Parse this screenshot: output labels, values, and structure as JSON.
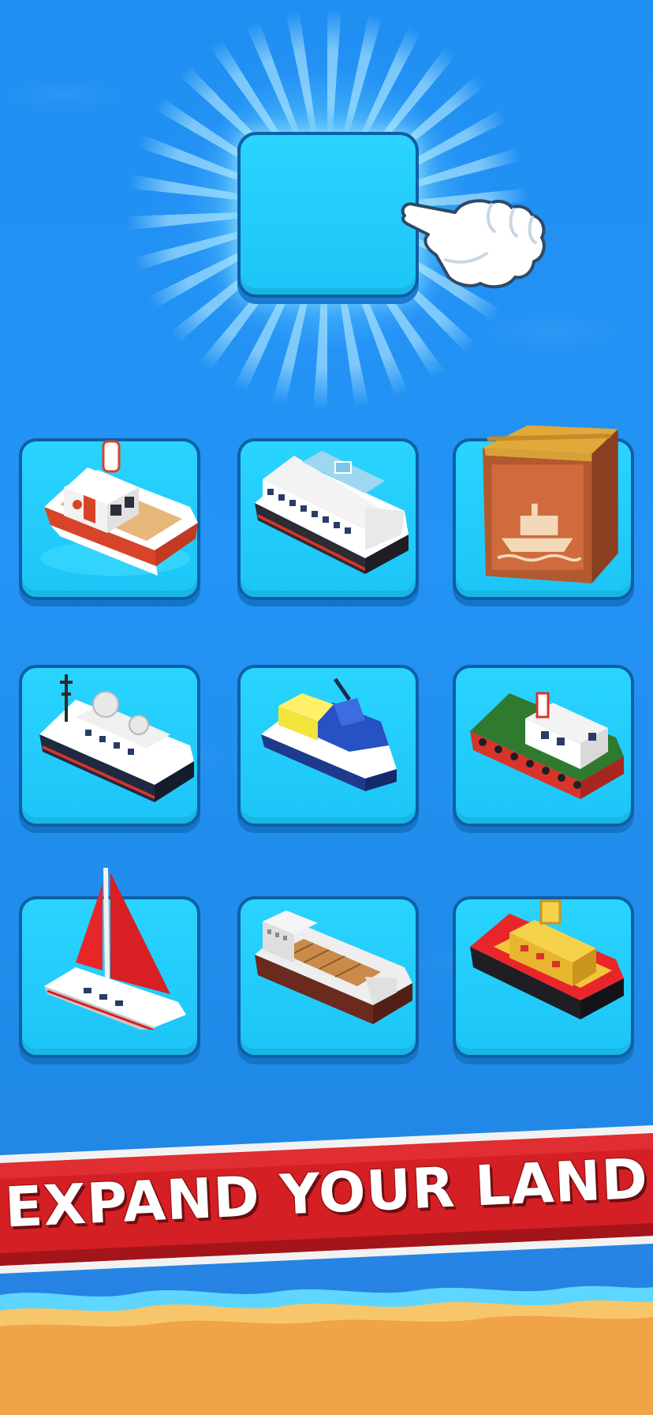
{
  "banner": {
    "text": "EXPAND YOUR LAND",
    "color_primary": "#d41f24",
    "color_text": "#ffffff"
  },
  "board": {
    "highlight_slot": "empty-tile",
    "pointer": "hand-pointer-icon",
    "items": [
      {
        "icon": "tugboat-icon"
      },
      {
        "icon": "cruise-ship-icon"
      },
      {
        "icon": "crate-icon"
      },
      {
        "icon": "research-ship-icon"
      },
      {
        "icon": "jet-ski-icon"
      },
      {
        "icon": "tug-green-icon"
      },
      {
        "icon": "sailboat-icon"
      },
      {
        "icon": "cargo-ship-icon"
      },
      {
        "icon": "fireboat-icon"
      }
    ]
  },
  "colors": {
    "sea": "#2090f2",
    "tile": "#22cdfb",
    "tile_border": "#0d5fa6",
    "sand": "#f0a347"
  }
}
